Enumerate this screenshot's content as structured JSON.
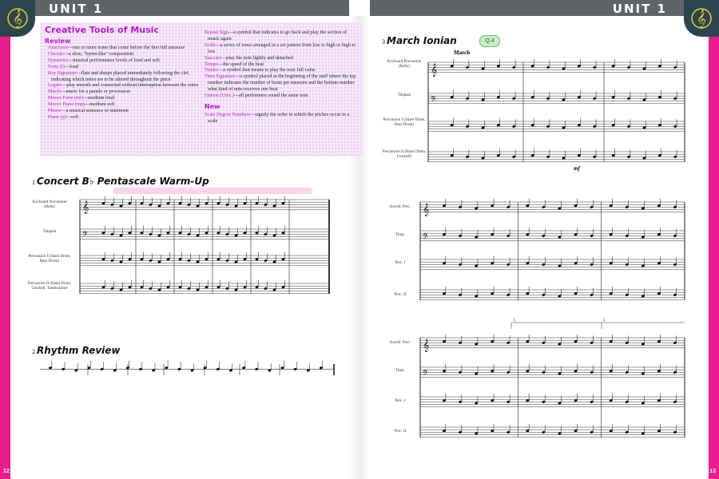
{
  "header": {
    "left_unit": "UNIT 1",
    "right_unit": "UNIT 1"
  },
  "page_numbers": {
    "left": "12",
    "right": "13"
  },
  "review_box": {
    "title": "Creative Tools of Music",
    "review_heading": "Review",
    "col1": [
      {
        "term": "Anacrusis",
        "def": "—one or more notes that come before the first full measure"
      },
      {
        "term": "Chorale",
        "def": "—a slow, \"hymn-like\" composition"
      },
      {
        "term": "Dynamics",
        "def": "—musical performance levels of loud and soft"
      },
      {
        "term": "Forte (f)",
        "def": "—loud"
      },
      {
        "term": "Key Signature",
        "def": "—flats and sharps placed immediately following the clef, indicating which notes are to be altered throughout the piece"
      },
      {
        "term": "Legato",
        "def": "—play smooth and connected without interruption between the notes"
      },
      {
        "term": "March",
        "def": "—music for a parade or procession"
      },
      {
        "term": "Mezzo Forte (mf)",
        "def": "—medium loud"
      },
      {
        "term": "Mezzo Piano (mp)",
        "def": "—medium soft"
      },
      {
        "term": "Phrase",
        "def": "—a musical sentence or statement"
      },
      {
        "term": "Piano (p)",
        "def": "—soft"
      }
    ],
    "col2": [
      {
        "term": "Repeat Sign",
        "def": "—a symbol that indicates to go back and play the section of music again"
      },
      {
        "term": "Scale",
        "def": "—a series of tones arranged in a set pattern from low to high or high to low"
      },
      {
        "term": "Staccato",
        "def": "—play the note lightly and detached"
      },
      {
        "term": "Tempo",
        "def": "—the speed of the beat"
      },
      {
        "term": "Tenuto",
        "def": "—a symbol that means to play the note full value"
      },
      {
        "term": "Time Signature",
        "def": "—a symbol placed at the beginning of the staff where the top number indicates the number of beats per measure and the bottom number what kind of note receives one beat"
      },
      {
        "term": "Unison (Unis.)",
        "def": "—all performers sound the same note"
      }
    ],
    "new_heading": "New",
    "new_entries": [
      {
        "term": "Scale Degree Numbers",
        "def": "—signify the order in which the pitches occur in a scale"
      }
    ]
  },
  "exercise1": {
    "number": "1",
    "title": "Concert B♭ Pentascale Warm-Up",
    "parts": [
      "Keyboard Percussion (Bells)",
      "Timpani",
      "Percussion I (Snare Drum, Bass Drum)",
      "Percussion II (Hand Drum, Cowbell, Tambourine)"
    ]
  },
  "exercise2": {
    "number": "2",
    "title": "Rhythm Review"
  },
  "exercise3": {
    "number": "3",
    "title": "March Ionian",
    "track": "Q.4",
    "tempo": "March",
    "parts": [
      "Keyboard Percussion (Bells)",
      "Timpani",
      "Percussion I (Snare Drum, Bass Drum)",
      "Percussion II (Hand Drum, Cowbell)"
    ],
    "dynamic": "mf"
  },
  "system2_parts": [
    "Keybd. Perc.",
    "Timp.",
    "Perc. I",
    "Perc. II"
  ],
  "system3_parts": [
    "Keybd. Perc.",
    "Timp.",
    "Perc. I",
    "Perc. II"
  ],
  "endings": {
    "first": "1.",
    "second": "2."
  },
  "colors": {
    "accent_pink": "#ec1c8c",
    "header_gray": "#5f6466",
    "term_purple": "#b81cc9",
    "badge_navy": "#2c4450"
  }
}
